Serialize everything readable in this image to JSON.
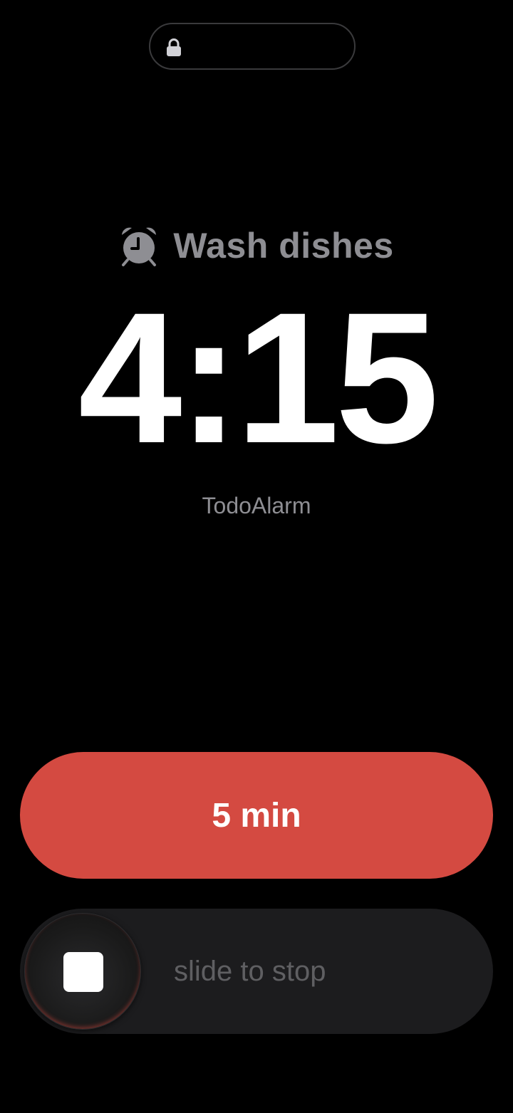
{
  "island": {
    "icon": "lock-icon"
  },
  "alarm": {
    "icon": "alarm-clock-icon",
    "title": "Wash dishes",
    "time": "4:15",
    "app_name": "TodoAlarm"
  },
  "snooze": {
    "label": "5 min",
    "color": "#d44a41"
  },
  "slider": {
    "label": "slide to stop",
    "knob_icon": "stop-square-icon"
  },
  "colors": {
    "background": "#000000",
    "secondary_text": "#8e8e93",
    "slider_track": "#1c1c1e"
  }
}
